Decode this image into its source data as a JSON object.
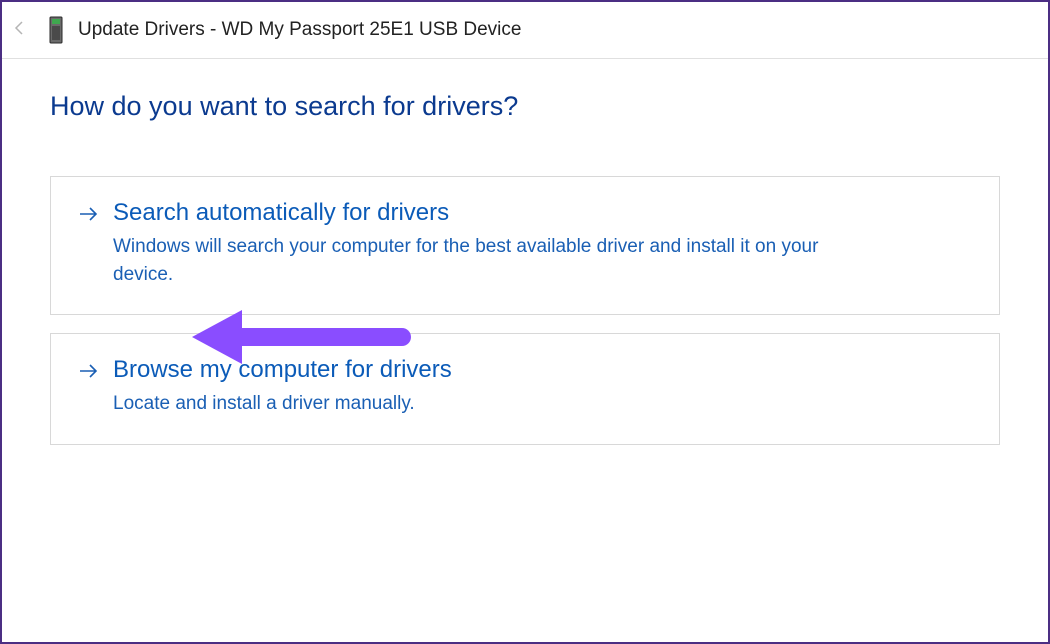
{
  "titlebar": {
    "title": "Update Drivers - WD My Passport 25E1 USB Device"
  },
  "heading": "How do you want to search for drivers?",
  "options": [
    {
      "title": "Search automatically for drivers",
      "description": "Windows will search your computer for the best available driver and install it on your device."
    },
    {
      "title": "Browse my computer for drivers",
      "description": "Locate and install a driver manually."
    }
  ],
  "annotation": {
    "color": "#8a4dff"
  }
}
